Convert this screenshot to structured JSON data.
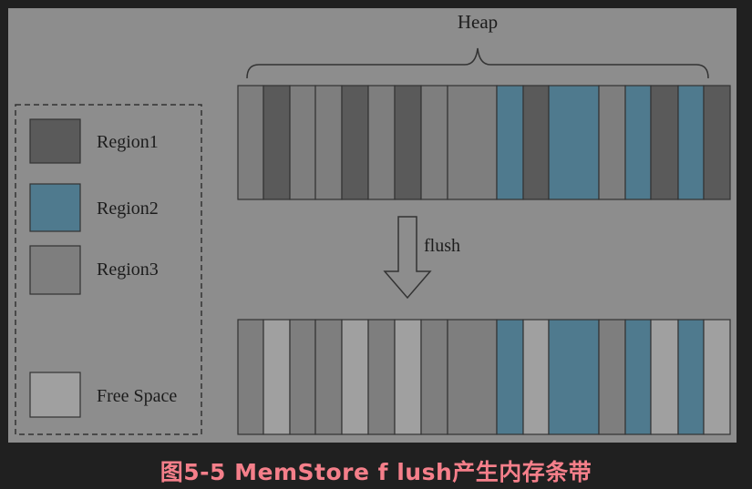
{
  "heap_label": "Heap",
  "flush_label": "flush",
  "legend": [
    {
      "key": "region1",
      "label": "Region1",
      "color": "#5a5a5a"
    },
    {
      "key": "region2",
      "label": "Region2",
      "color": "#4f7a8e"
    },
    {
      "key": "region3",
      "label": "Region3",
      "color": "#7e7e7e"
    },
    {
      "key": "free",
      "label": "Free Space",
      "color": "#a0a0a0"
    }
  ],
  "colors": {
    "panel": "#8d8d8d",
    "outer": "#202020",
    "stroke": "#333333",
    "caption": "#f57f8a"
  },
  "heap_before": [
    "region3",
    "region1",
    "region3",
    "region3",
    "region1",
    "region3",
    "region1",
    "region3",
    "region3",
    "region2",
    "region1",
    "region2",
    "region3",
    "region2",
    "region1",
    "region2",
    "region1"
  ],
  "heap_after": [
    "region3",
    "free",
    "region3",
    "region3",
    "free",
    "region3",
    "free",
    "region3",
    "region3",
    "region2",
    "free",
    "region2",
    "region3",
    "region2",
    "free",
    "region2",
    "free"
  ],
  "caption": "图5-5 MemStore f lush产生内存条带"
}
